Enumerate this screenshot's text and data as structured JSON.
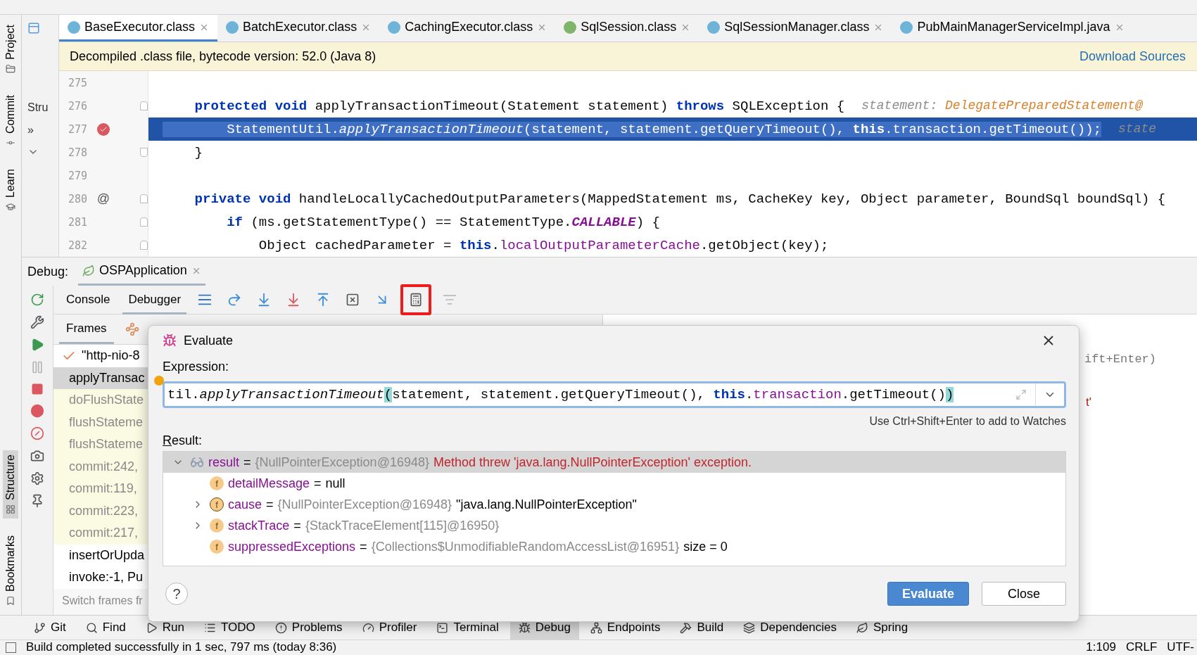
{
  "left_stripe": [
    {
      "label": "Project",
      "selected": false
    },
    {
      "label": "Commit",
      "selected": false
    },
    {
      "label": "Learn",
      "selected": false
    },
    {
      "label": "Structure",
      "selected": true
    },
    {
      "label": "Bookmarks",
      "selected": false
    }
  ],
  "side_panel": {
    "title": "Stru",
    "more": "»"
  },
  "tabs": [
    {
      "label": "BaseExecutor.class",
      "kind": "class",
      "selected": true
    },
    {
      "label": "BatchExecutor.class",
      "kind": "class",
      "selected": false
    },
    {
      "label": "CachingExecutor.class",
      "kind": "class",
      "selected": false
    },
    {
      "label": "SqlSession.class",
      "kind": "interface",
      "selected": false
    },
    {
      "label": "SqlSessionManager.class",
      "kind": "class",
      "selected": false
    },
    {
      "label": "PubMainManagerServiceImpl.java",
      "kind": "class",
      "selected": false
    }
  ],
  "notice": {
    "text": "Decompiled .class file, bytecode version: 52.0 (Java 8)",
    "link": "Download Sources"
  },
  "code_lines": [
    {
      "number": "275",
      "selected": false
    },
    {
      "number": "276",
      "fold_start": true,
      "selected": false,
      "tokens": [
        {
          "text": "    protected",
          "kind": "keyword"
        },
        {
          "text": " void",
          "kind": "keyword"
        },
        {
          "text": " applyTransactionTimeout(Statement statement) ",
          "kind": "plain"
        },
        {
          "text": "throws",
          "kind": "keyword"
        },
        {
          "text": " SQLException {",
          "kind": "plain"
        },
        {
          "text": "statement: ",
          "kind": "hint_label"
        },
        {
          "text": "DelegatePreparedStatement@",
          "kind": "hint_value"
        }
      ]
    },
    {
      "number": "277",
      "breakpoint": true,
      "selected": true,
      "tokens": [
        {
          "text": "        StatementUtil.",
          "kind": "plain"
        },
        {
          "text": "applyTransactionTimeout",
          "kind": "method"
        },
        {
          "text": "(statement, statement.getQueryTimeout(), ",
          "kind": "plain"
        },
        {
          "text": "this",
          "kind": "keyword"
        },
        {
          "text": ".",
          "kind": "plain"
        },
        {
          "text": "transaction",
          "kind": "field"
        },
        {
          "text": ".getTimeout());",
          "kind": "plain"
        },
        {
          "text": "state",
          "kind": "hint_label"
        }
      ]
    },
    {
      "number": "278",
      "fold_end": true,
      "selected": false,
      "tokens": [
        {
          "text": "    }",
          "kind": "plain"
        }
      ]
    },
    {
      "number": "279",
      "selected": false
    },
    {
      "number": "280",
      "marker": "@",
      "fold_start": true,
      "selected": false,
      "tokens": [
        {
          "text": "    private",
          "kind": "keyword"
        },
        {
          "text": " void",
          "kind": "keyword"
        },
        {
          "text": " handleLocallyCachedOutputParameters(MappedStatement ms, CacheKey key, Object parameter, BoundSql boundSql) {",
          "kind": "plain"
        }
      ]
    },
    {
      "number": "281",
      "fold_start": true,
      "selected": false,
      "tokens": [
        {
          "text": "        if",
          "kind": "keyword"
        },
        {
          "text": " (ms.getStatementType() == StatementType.",
          "kind": "plain"
        },
        {
          "text": "CALLABLE",
          "kind": "constant"
        },
        {
          "text": ") {",
          "kind": "plain"
        }
      ]
    },
    {
      "number": "282",
      "fold_start": true,
      "selected": false,
      "tokens": [
        {
          "text": "            Object cachedParameter = ",
          "kind": "plain"
        },
        {
          "text": "this",
          "kind": "keyword"
        },
        {
          "text": ".",
          "kind": "plain"
        },
        {
          "text": "localOutputParameterCache",
          "kind": "field"
        },
        {
          "text": ".getObject(key);",
          "kind": "plain"
        }
      ]
    }
  ],
  "debug": {
    "label": "Debug:",
    "session": "OSPApplication",
    "tabs": [
      {
        "label": "Console",
        "selected": false
      },
      {
        "label": "Debugger",
        "selected": true
      }
    ],
    "toolbar": [
      {
        "kind": "lines",
        "highlighted": false
      },
      {
        "kind": "step_over",
        "highlighted": false
      },
      {
        "kind": "step_into",
        "highlighted": false
      },
      {
        "kind": "force_step_into",
        "highlighted": false
      },
      {
        "kind": "step_out",
        "highlighted": false
      },
      {
        "kind": "drop_frame",
        "highlighted": false
      },
      {
        "kind": "run_to_cursor",
        "highlighted": false
      },
      {
        "kind": "evaluate",
        "highlighted": true
      },
      {
        "kind": "trace",
        "highlighted": false
      }
    ],
    "side_actions": [
      {
        "kind": "rerun",
        "disabled": false
      },
      {
        "kind": "wrench",
        "disabled": false
      },
      {
        "kind": "resume",
        "disabled": false
      },
      {
        "kind": "pause",
        "disabled": true
      },
      {
        "kind": "stop",
        "disabled": false
      },
      {
        "kind": "breakpoints",
        "disabled": false
      },
      {
        "kind": "mute",
        "disabled": false
      },
      {
        "kind": "camera",
        "disabled": false
      },
      {
        "kind": "settings",
        "disabled": false
      },
      {
        "kind": "pin",
        "disabled": false
      }
    ]
  },
  "frames": {
    "tab": "Frames",
    "items": [
      {
        "text": "\"http-nio-8",
        "kind": "thread",
        "library": false,
        "selected": false
      },
      {
        "text": "applyTransac",
        "kind": "frame",
        "library": false,
        "selected": true
      },
      {
        "text": "doFlushState",
        "kind": "frame",
        "library": true,
        "selected": false
      },
      {
        "text": "flushStateme",
        "kind": "frame",
        "library": true,
        "selected": false
      },
      {
        "text": "flushStateme",
        "kind": "frame",
        "library": true,
        "selected": false
      },
      {
        "text": "commit:242,",
        "kind": "frame",
        "library": true,
        "selected": false
      },
      {
        "text": "commit:119,",
        "kind": "frame",
        "library": true,
        "selected": false
      },
      {
        "text": "commit:223,",
        "kind": "frame",
        "library": true,
        "selected": false
      },
      {
        "text": "commit:217,",
        "kind": "frame",
        "library": true,
        "selected": false
      },
      {
        "text": "insertOrUpda",
        "kind": "frame",
        "library": false,
        "selected": false
      },
      {
        "text": "invoke:-1, Pu",
        "kind": "frame",
        "library": false,
        "selected": false
      }
    ],
    "footer": "Switch frames fr"
  },
  "variables": {
    "watch_hint": "ift+Enter)",
    "value_fragment": "t'"
  },
  "dialog": {
    "title": "Evaluate",
    "expression_label": "Expression:",
    "expression": [
      {
        "text": "til.",
        "kind": "plain"
      },
      {
        "text": "applyTransactionTimeout",
        "kind": "method"
      },
      {
        "text": "(",
        "kind": "bracket"
      },
      {
        "text": "statement, statement.getQueryTimeout(), ",
        "kind": "plain"
      },
      {
        "text": "this",
        "kind": "keyword"
      },
      {
        "text": ".",
        "kind": "plain"
      },
      {
        "text": "transaction",
        "kind": "field"
      },
      {
        "text": ".getTimeout()",
        "kind": "plain"
      },
      {
        "text": ")",
        "kind": "bracket"
      }
    ],
    "watch_hint": "Use Ctrl+Shift+Enter to add to Watches",
    "result_label": "Result:",
    "result": {
      "name": "result",
      "sep": "=",
      "ref": "{NullPointerException@16948}",
      "message": "Method threw 'java.lang.NullPointerException' exception.",
      "expanded": true,
      "selected": true,
      "children": [
        {
          "badge": "f",
          "recursive": false,
          "name": "detailMessage",
          "sep": "=",
          "value": "null"
        },
        {
          "badge": "f",
          "recursive": true,
          "expanded": false,
          "name": "cause",
          "sep": "=",
          "ref": "{NullPointerException@16948}",
          "value": "\"java.lang.NullPointerException\""
        },
        {
          "badge": "f",
          "recursive": false,
          "expanded": false,
          "name": "stackTrace",
          "sep": "=",
          "ref": "{StackTraceElement[115]@16950}"
        },
        {
          "badge": "f",
          "recursive": false,
          "name": "suppressedExceptions",
          "sep": "=",
          "ref": "{Collections$UnmodifiableRandomAccessList@16951}",
          "value": "size = 0"
        }
      ]
    },
    "buttons": [
      {
        "label": "Evaluate",
        "primary": true
      },
      {
        "label": "Close",
        "primary": false
      }
    ],
    "help": "?"
  },
  "tool_windows": [
    {
      "label": "Git",
      "kind": "git",
      "selected": false
    },
    {
      "label": "Find",
      "kind": "find",
      "selected": false
    },
    {
      "label": "Run",
      "kind": "run",
      "selected": false
    },
    {
      "label": "TODO",
      "kind": "todo",
      "selected": false
    },
    {
      "label": "Problems",
      "kind": "problems",
      "selected": false
    },
    {
      "label": "Profiler",
      "kind": "profiler",
      "selected": false
    },
    {
      "label": "Terminal",
      "kind": "terminal",
      "selected": false
    },
    {
      "label": "Debug",
      "kind": "debug",
      "selected": true
    },
    {
      "label": "Endpoints",
      "kind": "endpoints",
      "selected": false
    },
    {
      "label": "Build",
      "kind": "build",
      "selected": false
    },
    {
      "label": "Dependencies",
      "kind": "dependencies",
      "selected": false
    },
    {
      "label": "Spring",
      "kind": "spring",
      "selected": false
    }
  ],
  "status_bar": {
    "checked": false,
    "message": "Build completed successfully in 1 sec, 797 ms (today 8:36)",
    "position": "1:109",
    "line_separator": "CRLF",
    "encoding": "UTF-"
  }
}
